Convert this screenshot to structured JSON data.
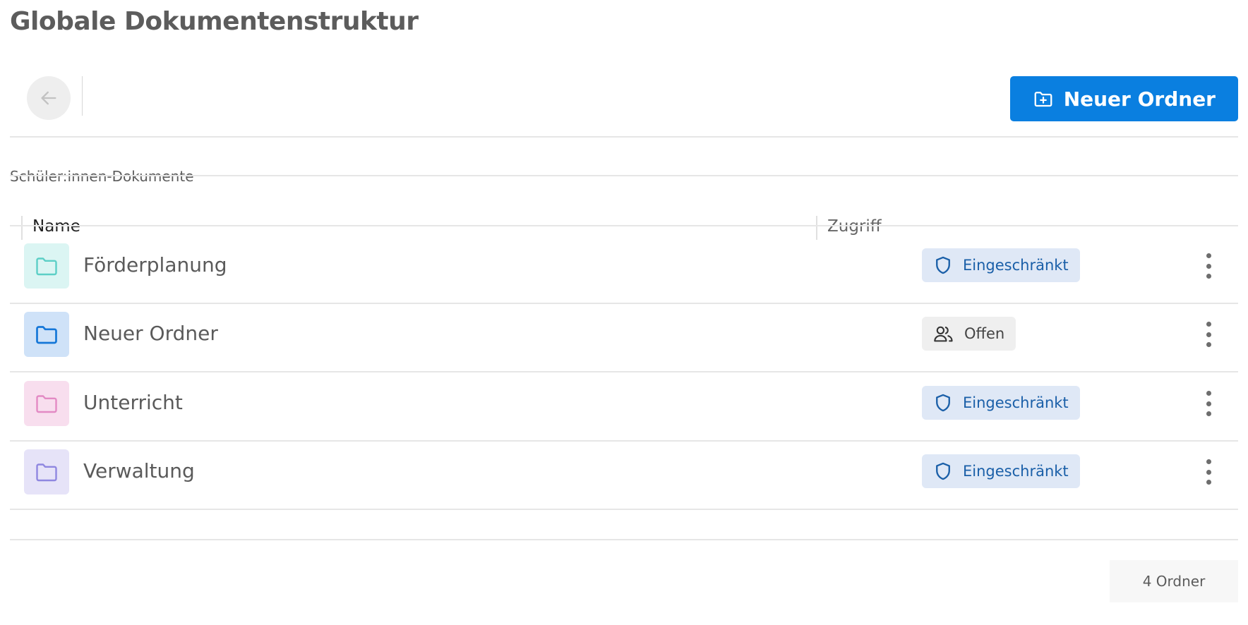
{
  "page": {
    "title": "Globale Dokumentenstruktur"
  },
  "toolbar": {
    "back_icon": "arrow-left-icon",
    "new_folder_label": "Neuer Ordner",
    "new_folder_icon": "folder-plus-icon",
    "accent": "#0a7fe0"
  },
  "breadcrumb": "Schüler:innen-Dokumente",
  "table": {
    "columns": [
      "Name",
      "Zugriff"
    ],
    "rows": [
      {
        "name": "Förderplanung",
        "access": "Eingeschränkt",
        "access_type": "restricted",
        "folder_color": "#5ccfc6",
        "tile_bg": "#dbf5f3"
      },
      {
        "name": "Neuer Ordner",
        "access": "Offen",
        "access_type": "open",
        "folder_color": "#1577d8",
        "tile_bg": "#cfe2f8"
      },
      {
        "name": "Unterricht",
        "access": "Eingeschränkt",
        "access_type": "restricted",
        "folder_color": "#e38ac4",
        "tile_bg": "#f8deee"
      },
      {
        "name": "Verwaltung",
        "access": "Eingeschränkt",
        "access_type": "restricted",
        "folder_color": "#8f87e0",
        "tile_bg": "#e6e3f8"
      }
    ]
  },
  "footer": {
    "count_label": "4 Ordner"
  }
}
